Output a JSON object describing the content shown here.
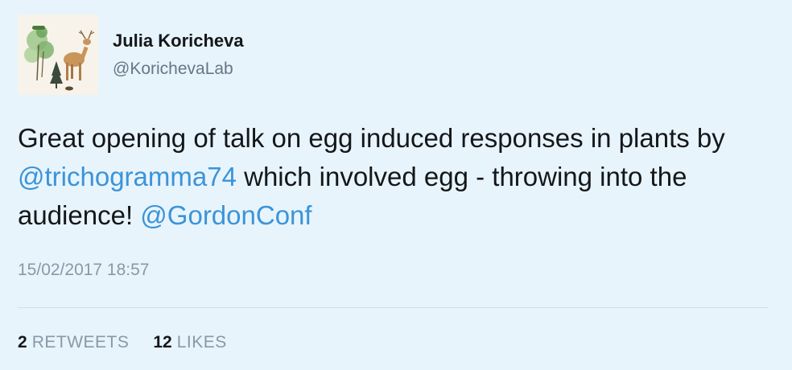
{
  "author": {
    "display_name": "Julia Koricheva",
    "handle": "@KorichevaLab"
  },
  "tweet": {
    "text_1": "Great opening of talk on egg induced responses in plants by ",
    "mention_1": "@trichogramma74",
    "text_2": " which involved egg - throwing into the audience! ",
    "mention_2": "@GordonConf"
  },
  "timestamp": "15/02/2017 18:57",
  "stats": {
    "retweets_count": "2",
    "retweets_label": "RETWEETS",
    "likes_count": "12",
    "likes_label": "LIKES"
  },
  "colors": {
    "background": "#e8f4fc",
    "link": "#3b94d9",
    "muted": "#8899a6"
  }
}
